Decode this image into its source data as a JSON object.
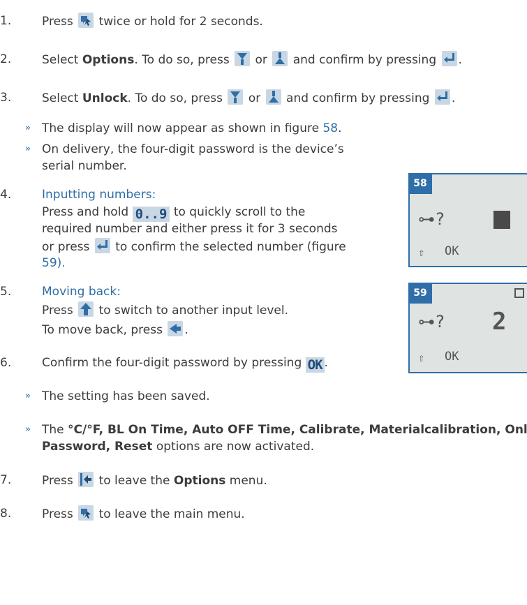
{
  "steps": [
    {
      "n": "1.",
      "pre": "Press",
      "mid": "twice or hold for 2 seconds."
    },
    {
      "n": "2.",
      "pre": "Select",
      "bold": "Options",
      "post": ". To do so, press",
      "or": "or",
      "confirm": "and confirm by pressing"
    },
    {
      "n": "3.",
      "pre": "Select",
      "bold": "Unlock",
      "post": ". To do so, press",
      "or": "or",
      "confirm": "and confirm by pressing"
    },
    {
      "n": "4.",
      "heading": "Inputting numbers:",
      "l1a": "Press and hold",
      "l1b": "to quickly scroll to the",
      "l2": "required number and either press it for 3 seconds",
      "l3a": "or press",
      "l3b": "to confirm the selected number (figure",
      "l4": "59)."
    },
    {
      "n": "5.",
      "heading": "Moving back:",
      "l1a": "Press",
      "l1b": "to switch to another input level.",
      "l2a": "To move back, press"
    },
    {
      "n": "6.",
      "pre": "Confirm the four-digit password by pressing"
    },
    {
      "n": "7.",
      "pre": "Press",
      "mid": "to leave the",
      "bold": "Options",
      "post": "menu."
    },
    {
      "n": "8.",
      "pre": "Press",
      "mid": "to leave the main menu."
    }
  ],
  "bullets": {
    "b1_pre": "The display will now appear as shown in figure",
    "b1_link": "58",
    "b2_l1": "On delivery, the four-digit password is the device’s",
    "b2_l2": "serial number.",
    "b3": "The setting has been saved.",
    "b4_pre": "The",
    "b4_bold": "°C/°F, BL On Time, Auto OFF Time, Calibrate, Materialcalibration, Onl",
    "b4_bold2": "Password, Reset",
    "b4_post": "options are now activated."
  },
  "icons": {
    "num_label": "0..9",
    "ok_label": "OK"
  },
  "figures": [
    {
      "tag": "58",
      "symbol": "⊶?",
      "arrow": "⇧",
      "ok": "OK"
    },
    {
      "tag": "59",
      "symbol": "⊶?",
      "digits": "2",
      "arrow": "⇧",
      "ok": "OK"
    }
  ]
}
